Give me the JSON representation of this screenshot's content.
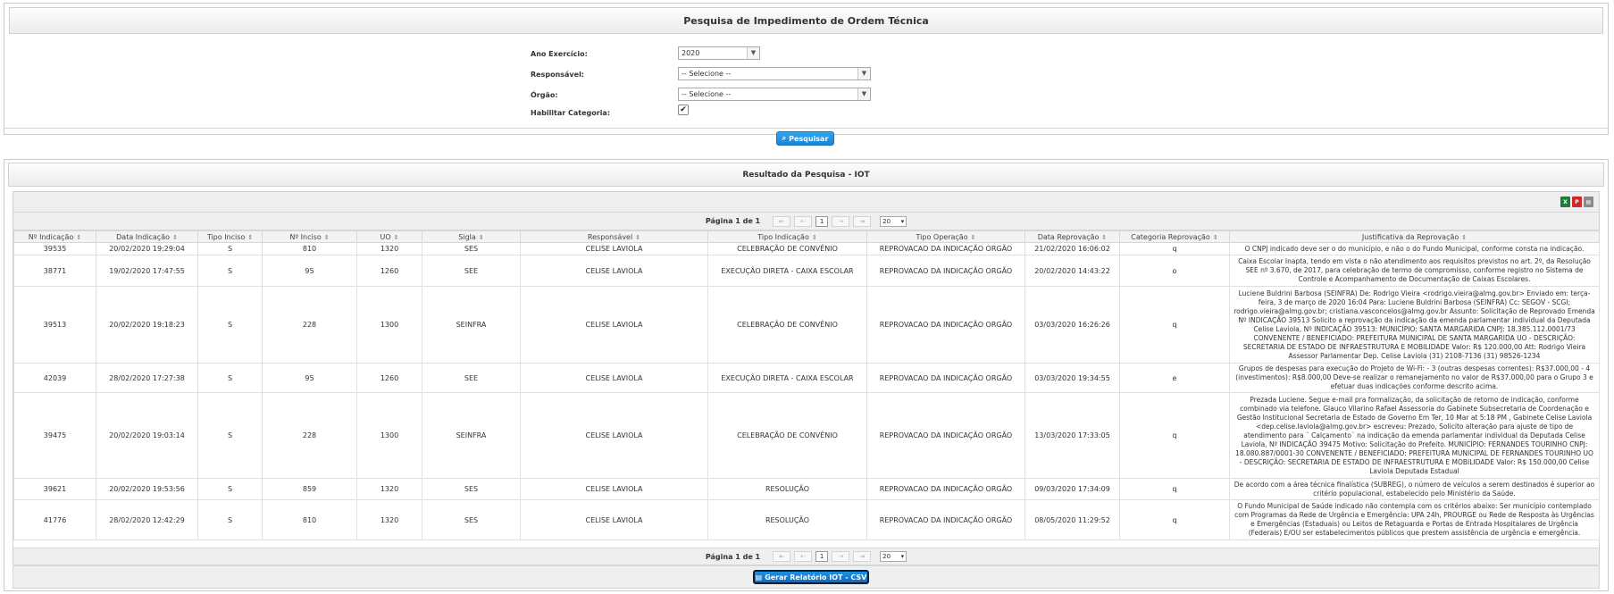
{
  "search": {
    "title": "Pesquisa de Impedimento de Ordem Técnica",
    "fields": {
      "ano_label": "Ano Exercício:",
      "ano_value": "2020",
      "responsavel_label": "Responsável:",
      "responsavel_value": "-- Selecione --",
      "orgao_label": "Órgão:",
      "orgao_value": "-- Selecione --",
      "categoria_label": "Habilitar Categoria:",
      "categoria_checked": true
    },
    "search_button": "Pesquisar"
  },
  "results": {
    "title": "Resultado da Pesquisa - IOT",
    "export_icons": [
      "excel-icon",
      "pdf-icon",
      "print-icon"
    ],
    "pager": {
      "text": "Página 1 de 1",
      "current_page": "1",
      "first": "⇤",
      "prev": "⇠",
      "next": "⇢",
      "last": "⇥",
      "page_size": "20"
    },
    "columns": [
      "Nº Indicação",
      "Data Indicação",
      "Tipo Inciso",
      "Nº Inciso",
      "UO",
      "Sigla",
      "Responsável",
      "Tipo Indicação",
      "Tipo Operação",
      "Data Reprovação",
      "Categoria Reprovação",
      "Justificativa da Reprovação"
    ],
    "rows": [
      [
        "39535",
        "20/02/2020 19:29:04",
        "S",
        "810",
        "1320",
        "SES",
        "CELISE LAVIOLA",
        "CELEBRAÇÃO DE CONVÊNIO",
        "REPROVACAO DA INDICAÇÃO ORGÃO",
        "21/02/2020 16:06:02",
        "q",
        "O CNPJ indicado deve ser o do município, e não o do Fundo Municipal, conforme consta na indicação."
      ],
      [
        "38771",
        "19/02/2020 17:47:55",
        "S",
        "95",
        "1260",
        "SEE",
        "CELISE LAVIOLA",
        "EXECUÇÃO DIRETA - CAIXA ESCOLAR",
        "REPROVACAO DA INDICAÇÃO ORGÃO",
        "20/02/2020 14:43:22",
        "o",
        "Caixa Escolar Inapta, tendo em vista o não atendimento aos requisitos previstos no art. 2º, da Resolução SEE nº 3.670, de 2017, para celebração de termo de compromisso, conforme registro no Sistema de Controle e Acompanhamento de Documentação de Caixas Escolares."
      ],
      [
        "39513",
        "20/02/2020 19:18:23",
        "S",
        "228",
        "1300",
        "SEINFRA",
        "CELISE LAVIOLA",
        "CELEBRAÇÃO DE CONVÊNIO",
        "REPROVACAO DA INDICAÇÃO ORGÃO",
        "03/03/2020 16:26:26",
        "q",
        "Luciene Buldrini Barbosa (SEINFRA) De: Rodrigo Vieira <rodrigo.vieira@almg.gov.br> Enviado em: terça-feira, 3 de março de 2020 16:04 Para: Luciene Buldrini Barbosa (SEINFRA) Cc: SEGOV - SCGI; rodrigo.vieira@almg.gov.br; cristiana.vasconcelos@almg.gov.br Assunto: Solicitação de Reprovado Emenda Nº INDICAÇÃO 39513 Solicito a reprovação da indicação da emenda parlamentar individual da Deputada Celise Laviola, Nº INDICAÇÃO 39513: MUNICÍPIO: SANTA MARGARIDA CNPJ: 18.385.112.0001/73 CONVENENTE / BENEFICIADO: PREFEITURA MUNICIPAL DE SANTA MARGARIDA UO - DESCRIÇÃO: SECRETARIA DE ESTADO DE INFRAESTRUTURA E MOBILIDADE Valor: R$ 120.000,00 Att: Rodrigo Vieira Assessor Parlamentar Dep. Celise Laviola (31) 2108-7136 (31) 98526-1234"
      ],
      [
        "42039",
        "28/02/2020 17:27:38",
        "S",
        "95",
        "1260",
        "SEE",
        "CELISE LAVIOLA",
        "EXECUÇÃO DIRETA - CAIXA ESCOLAR",
        "REPROVACAO DA INDICAÇÃO ORGÃO",
        "03/03/2020 19:34:55",
        "e",
        "Grupos de despesas para execução do Projeto de Wi-Fi: - 3 (outras despesas correntes): R$37.000,00 - 4 (investimentos): R$8.000,00 Deve-se realizar o remanejamento no valor de R$37.000,00 para o Grupo 3 e efetuar duas indicações conforme descrito acima."
      ],
      [
        "39475",
        "20/02/2020 19:03:14",
        "S",
        "228",
        "1300",
        "SEINFRA",
        "CELISE LAVIOLA",
        "CELEBRAÇÃO DE CONVÊNIO",
        "REPROVACAO DA INDICAÇÃO ORGÃO",
        "13/03/2020 17:33:05",
        "q",
        "Prezada Luciene. Segue e-mail pra formalização, da solicitação de retorno de indicação, conforme combinado via telefone. Glauco Vilarino Rafael Assessoria do Gabinete Subsecretaria de Coordenação e Gestão Institucional Secretaria de Estado de Governo Em Ter, 10 Mar at 5:18 PM , Gabinete Celise Laviola <dep.celise.laviola@almg.gov.br> escreveu: Prezado, Solicito alteração para ajuste de tipo de atendimento para ¨ Calçamento¨ na indicação da emenda parlamentar individual da Deputada Celise Laviola, Nº INDICAÇÃO 39475 Motivo: Solicitação do Prefeito. MUNICÍPIO: FERNANDES TOURINHO CNPJ: 18.080.887/0001-30 CONVENENTE / BENEFICIADO: PREFEITURA MUNICIPAL DE FERNANDES TOURINHO UO - DESCRIÇÃO: SECRETARIA DE ESTADO DE INFRAESTRUTURA E MOBILIDADE Valor: R$ 150.000,00 Celise Laviola Deputada Estadual"
      ],
      [
        "39621",
        "20/02/2020 19:53:56",
        "S",
        "859",
        "1320",
        "SES",
        "CELISE LAVIOLA",
        "RESOLUÇÃO",
        "REPROVACAO DA INDICAÇÃO ORGÃO",
        "09/03/2020 17:34:09",
        "q",
        "De acordo com a área técnica finalística (SUBREG), o número de veículos a serem destinados é superior ao critério populacional, estabelecido pelo Ministério da Saúde."
      ],
      [
        "41776",
        "28/02/2020 12:42:29",
        "S",
        "810",
        "1320",
        "SES",
        "CELISE LAVIOLA",
        "RESOLUÇÃO",
        "REPROVACAO DA INDICAÇÃO ORGÃO",
        "08/05/2020 11:29:52",
        "q",
        "O Fundo Municipal de Saúde indicado não contempla com os critérios abaixo: Ser município contemplado com Programas da Rede de Urgência e Emergência: UPA 24h, PROURGE ou Rede de Resposta às Urgências e Emergências (Estaduais) ou Leitos de Retaguarda e Portas de Entrada Hospitalares de Urgência (Federais) E/OU ser estabelecimentos públicos que prestem assistência de urgência e emergência."
      ]
    ],
    "report_button": "Gerar Relatório IOT - CSV"
  }
}
